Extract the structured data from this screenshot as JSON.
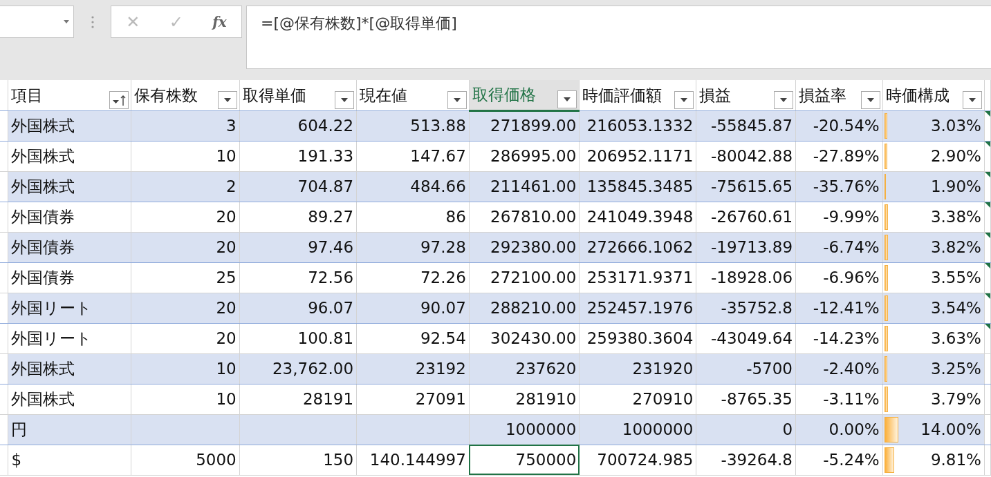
{
  "formula_bar": {
    "cancel": "✕",
    "enter": "✓",
    "function": "fx",
    "formula": "=[@保有株数]*[@取得単価]"
  },
  "table": {
    "columns": [
      {
        "label": "項目",
        "sorted": true,
        "selected": false
      },
      {
        "label": "保有株数",
        "sorted": false,
        "selected": false
      },
      {
        "label": "取得単価",
        "sorted": false,
        "selected": false
      },
      {
        "label": "現在値",
        "sorted": false,
        "selected": false
      },
      {
        "label": "取得価格",
        "sorted": false,
        "selected": true
      },
      {
        "label": "時価評価額",
        "sorted": false,
        "selected": false
      },
      {
        "label": "損益",
        "sorted": false,
        "selected": false
      },
      {
        "label": "損益率",
        "sorted": false,
        "selected": false
      },
      {
        "label": "時価構成",
        "sorted": false,
        "selected": false
      }
    ],
    "rows": [
      {
        "cells": [
          "外国株式",
          "3",
          "604.22",
          "513.88",
          "271899.00",
          "216053.1332",
          "-55845.87",
          "-20.54%",
          "3.03%"
        ],
        "level": 0.03,
        "flag": true,
        "selected": false
      },
      {
        "cells": [
          "外国株式",
          "10",
          "191.33",
          "147.67",
          "286995.00",
          "206952.1171",
          "-80042.88",
          "-27.89%",
          "2.90%"
        ],
        "level": 0.029,
        "flag": true,
        "selected": false
      },
      {
        "cells": [
          "外国株式",
          "2",
          "704.87",
          "484.66",
          "211461.00",
          "135845.3485",
          "-75615.65",
          "-35.76%",
          "1.90%"
        ],
        "level": 0.019,
        "flag": true,
        "selected": false
      },
      {
        "cells": [
          "外国債券",
          "20",
          "89.27",
          "86",
          "267810.00",
          "241049.3948",
          "-26760.61",
          "-9.99%",
          "3.38%"
        ],
        "level": 0.034,
        "flag": true,
        "selected": false
      },
      {
        "cells": [
          "外国債券",
          "20",
          "97.46",
          "97.28",
          "292380.00",
          "272666.1062",
          "-19713.89",
          "-6.74%",
          "3.82%"
        ],
        "level": 0.038,
        "flag": true,
        "selected": false
      },
      {
        "cells": [
          "外国債券",
          "25",
          "72.56",
          "72.26",
          "272100.00",
          "253171.9371",
          "-18928.06",
          "-6.96%",
          "3.55%"
        ],
        "level": 0.035,
        "flag": true,
        "selected": false
      },
      {
        "cells": [
          "外国リート",
          "20",
          "96.07",
          "90.07",
          "288210.00",
          "252457.1976",
          "-35752.8",
          "-12.41%",
          "3.54%"
        ],
        "level": 0.035,
        "flag": true,
        "selected": false
      },
      {
        "cells": [
          "外国リート",
          "20",
          "100.81",
          "92.54",
          "302430.00",
          "259380.3604",
          "-43049.64",
          "-14.23%",
          "3.63%"
        ],
        "level": 0.036,
        "flag": true,
        "selected": false
      },
      {
        "cells": [
          "外国株式",
          "10",
          "23,762.00",
          "23192",
          "237620",
          "231920",
          "-5700",
          "-2.40%",
          "3.25%"
        ],
        "level": 0.032,
        "flag": false,
        "selected": false
      },
      {
        "cells": [
          "外国株式",
          "10",
          "28191",
          "27091",
          "281910",
          "270910",
          "-8765.35",
          "-3.11%",
          "3.79%"
        ],
        "level": 0.038,
        "flag": false,
        "selected": false
      },
      {
        "cells": [
          "円",
          "",
          "",
          "",
          "1000000",
          "1000000",
          "0",
          "0.00%",
          "14.00%"
        ],
        "level": 0.14,
        "flag": false,
        "selected": false
      },
      {
        "cells": [
          "$",
          "5000",
          "150",
          "140.144997",
          "750000",
          "700724.985",
          "-39264.8",
          "-5.24%",
          "9.81%"
        ],
        "level": 0.098,
        "flag": false,
        "selected": true
      }
    ]
  }
}
